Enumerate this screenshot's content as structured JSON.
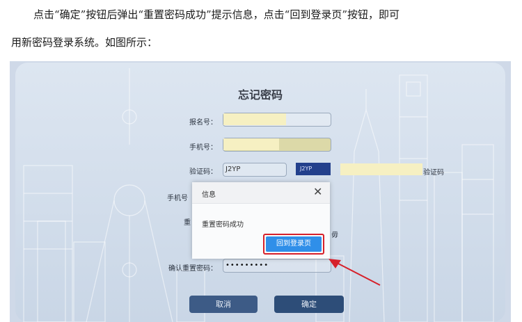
{
  "doc": {
    "para1": "点击“确定”按钮后弹出“重置密码成功”提示信息，点击“回到登录页”按钮，即可",
    "para2": "用新密码登录系统。如图所示："
  },
  "form": {
    "title": "忘记密码",
    "reg_label": "报名号：",
    "phone_label": "手机号：",
    "captcha_label": "验证码：",
    "captcha_value": "J2YP",
    "captcha_image_text": "J2YP",
    "captcha_hint": "验证码",
    "phone_code_label": "手机号",
    "reset_label_fragment": "重",
    "confirm_pwd_label": "确认重置密码：",
    "confirm_pwd_value": "•••••••••",
    "side_char": "毋",
    "cancel_label": "取消",
    "confirm_label": "确定"
  },
  "dialog": {
    "title": "信息",
    "close_glyph": "✕",
    "message": "重置密码成功",
    "button_label": "回到登录页"
  },
  "colors": {
    "highlight": "#f6f0c2",
    "dialog_button": "#2f8fe9",
    "annotation_red": "#d6202a"
  }
}
